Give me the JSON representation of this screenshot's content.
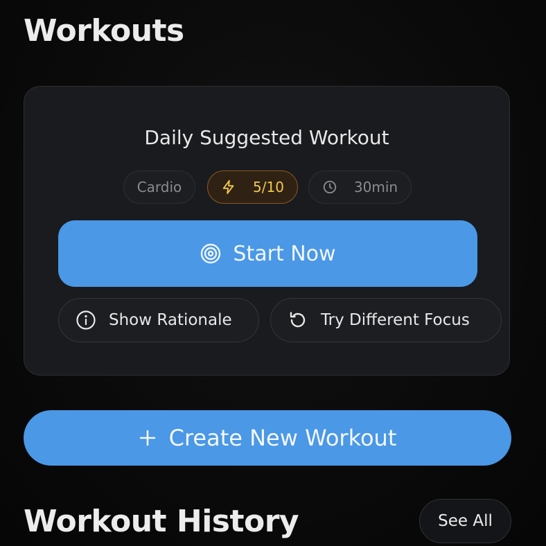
{
  "header": {
    "title": "Workouts"
  },
  "suggested": {
    "title": "Daily Suggested Workout",
    "tags": {
      "type": "Cardio",
      "intensity": "5/10",
      "intensity_icon": "lightning-icon",
      "duration": "30min",
      "duration_icon": "clock-icon"
    },
    "start_label": "Start Now",
    "start_icon": "target-icon",
    "rationale_label": "Show Rationale",
    "rationale_icon": "info-icon",
    "focus_label": "Try Different Focus",
    "focus_icon": "refresh-icon"
  },
  "create": {
    "label": "Create New Workout",
    "icon": "plus-icon"
  },
  "history": {
    "title": "Workout History",
    "see_all_label": "See All"
  },
  "colors": {
    "accent": "#4a98e6",
    "intensity": "#f2c94c",
    "card_bg": "#1a1b1f",
    "page_bg": "#0a0a0a"
  }
}
